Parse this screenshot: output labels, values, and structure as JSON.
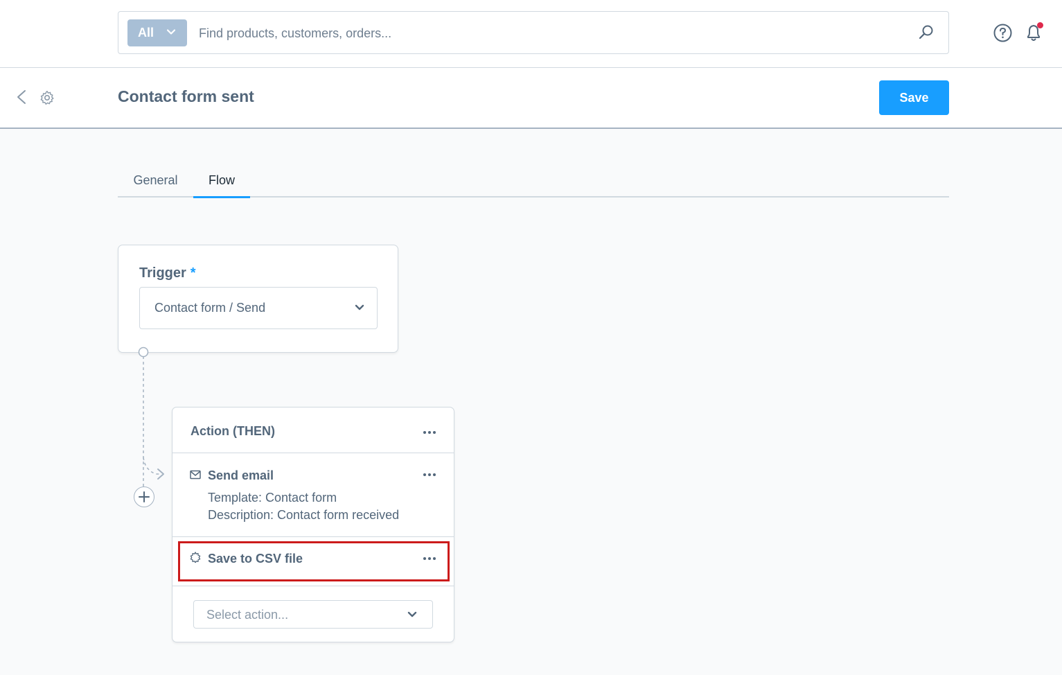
{
  "search": {
    "filter_label": "All",
    "placeholder": "Find products, customers, orders...",
    "value": ""
  },
  "header": {
    "title": "Contact form sent",
    "save_label": "Save"
  },
  "tabs": [
    {
      "label": "General",
      "active": false
    },
    {
      "label": "Flow",
      "active": true
    }
  ],
  "trigger": {
    "label": "Trigger",
    "required_mark": "*",
    "selected": "Contact form / Send"
  },
  "action": {
    "title": "Action (THEN)",
    "sequences": [
      {
        "icon": "mail-icon",
        "name": "Send email",
        "details": [
          "Template: Contact form",
          "Description: Contact form received"
        ]
      },
      {
        "icon": "puzzle-gear-icon",
        "name": "Save to CSV file",
        "details": [],
        "highlighted": true
      }
    ],
    "select_placeholder": "Select action..."
  },
  "colors": {
    "accent": "#189eff",
    "text": "#52667a",
    "highlight": "#cc1b1b",
    "notification": "#de294c"
  }
}
